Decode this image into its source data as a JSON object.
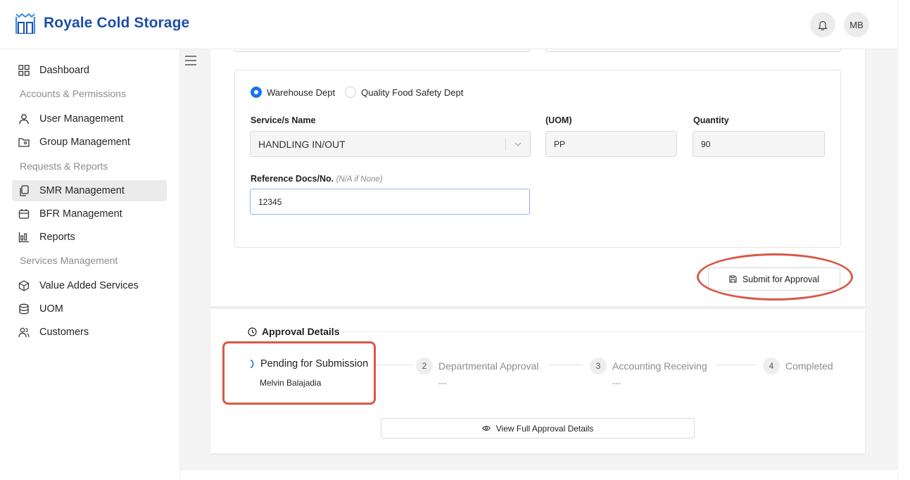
{
  "app": {
    "brand": "Royale Cold Storage",
    "avatar_initials": "MB",
    "accent": "#1d4fa8"
  },
  "sidebar": {
    "items": [
      {
        "label": "Dashboard",
        "icon": "dashboard-icon"
      },
      {
        "section": "Accounts & Permissions"
      },
      {
        "label": "User Management",
        "icon": "user-icon"
      },
      {
        "label": "Group Management",
        "icon": "folder-users-icon"
      },
      {
        "section": "Requests & Reports"
      },
      {
        "label": "SMR Management",
        "icon": "copy-icon",
        "active": true
      },
      {
        "label": "BFR Management",
        "icon": "calendar-box-icon"
      },
      {
        "label": "Reports",
        "icon": "bar-chart-icon"
      },
      {
        "section": "Services Management"
      },
      {
        "label": "Value Added Services",
        "icon": "package-icon"
      },
      {
        "label": "UOM",
        "icon": "database-icon"
      },
      {
        "label": "Customers",
        "icon": "users-icon"
      }
    ]
  },
  "form": {
    "department_options": [
      "Warehouse Dept",
      "Quality Food Safety Dept"
    ],
    "selected_department": "Warehouse Dept",
    "service_label": "Service/s Name",
    "service_value": "HANDLING IN/OUT",
    "uom_label": "(UOM)",
    "uom_value": "PP",
    "quantity_label": "Quantity",
    "quantity_value": "90",
    "reference_label": "Reference Docs/No.",
    "reference_hint": "(N/A if None)",
    "reference_value": "12345",
    "submit_label": "Submit for Approval"
  },
  "approval": {
    "title": "Approval Details",
    "steps": [
      {
        "label": "Pending for Submission",
        "sub": "Melvin Balajadia",
        "status": "active"
      },
      {
        "number": "2",
        "label": "Departmental Approval",
        "sub": "---"
      },
      {
        "number": "3",
        "label": "Accounting Receiving",
        "sub": "---"
      },
      {
        "number": "4",
        "label": "Completed"
      }
    ],
    "view_label": "View Full Approval Details"
  },
  "colors": {
    "annotation": "#d65a45",
    "radio_checked": "#1a73e8"
  }
}
